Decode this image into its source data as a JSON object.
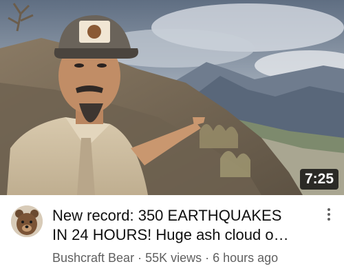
{
  "video": {
    "duration": "7:25",
    "title_line1": "New record: 350 EARTHQUAKES",
    "title_line2": "IN 24 HOURS! Huge ash cloud o…",
    "channel": "Bushcraft Bear",
    "views": "55K views",
    "age": "6 hours ago",
    "separator": "·"
  },
  "icons": {
    "menu": "more-vertical-icon",
    "avatar": "bear-avatar"
  }
}
